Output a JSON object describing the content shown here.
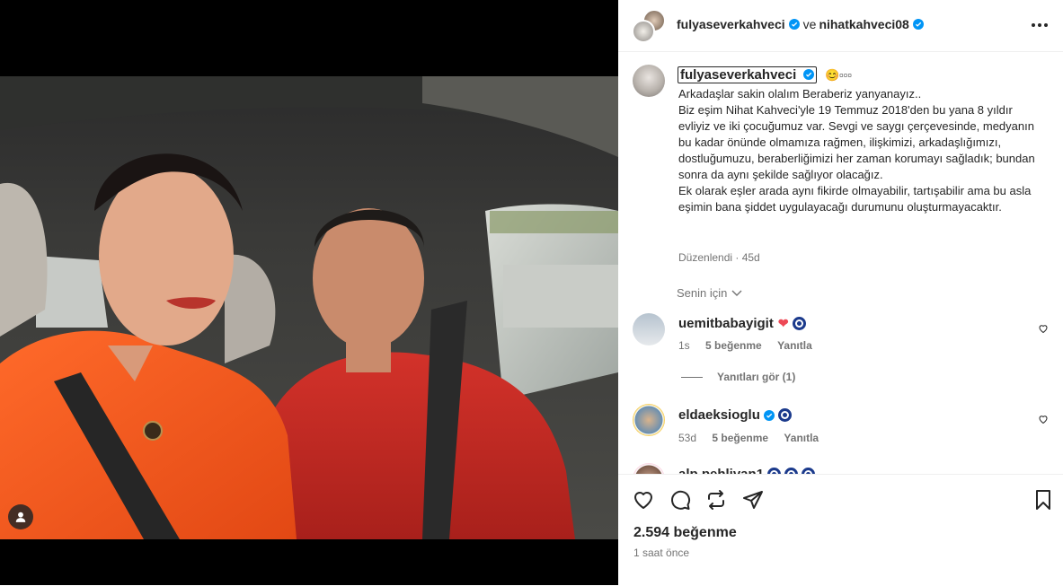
{
  "header": {
    "author1": "fulyaseverkahveci",
    "conj": "ve",
    "author2": "nihatkahveci08"
  },
  "caption": {
    "username": "fulyaseverkahveci",
    "emojis": "😊▫▫▫",
    "text": "Arkadaşlar sakin olalım Beraberiz yanyanayız..\nBiz eşim Nihat Kahveci'yle 19 Temmuz 2018'den bu yana 8 yıldır evliyiz ve iki çocuğumuz var. Sevgi ve saygı çerçevesinde, medyanın bu kadar önünde olmamıza rağmen, ilişkimizi, arkadaşlığımızı, dostluğumuzu, beraberliğimizi her zaman korumayı sağladık; bundan sonra da aynı şekilde sağlıyor olacağız.\nEk olarak eşler arada aynı fikirde olmayabilir, tartışabilir ama bu asla eşimin bana şiddet uygulayacağı durumunu oluşturmayacaktır.",
    "meta": "Düzenlendi · 45d"
  },
  "filter": {
    "label": "Senin için"
  },
  "comments": [
    {
      "username": "uemitbabayigit",
      "time": "1s",
      "likes": "5 beğenme",
      "reply": "Yanıtla",
      "view_replies": "Yanıtları gör (1)"
    },
    {
      "username": "eldaeksioglu",
      "time": "53d",
      "likes": "5 beğenme",
      "reply": "Yanıtla"
    },
    {
      "username": "alp.pehlivan1"
    }
  ],
  "footer": {
    "likes": "2.594 beğenme",
    "time": "1 saat önce"
  },
  "colors": {
    "verified": "#0095f6",
    "secondary_text": "#737373",
    "heart": "#ed4956",
    "evil_eye": "#1b3a8c"
  },
  "icons": [
    "more-icon",
    "heart-icon",
    "comment-icon",
    "repost-icon",
    "share-icon",
    "save-icon",
    "user-tag-icon",
    "chevron-down-icon",
    "verified-icon"
  ]
}
